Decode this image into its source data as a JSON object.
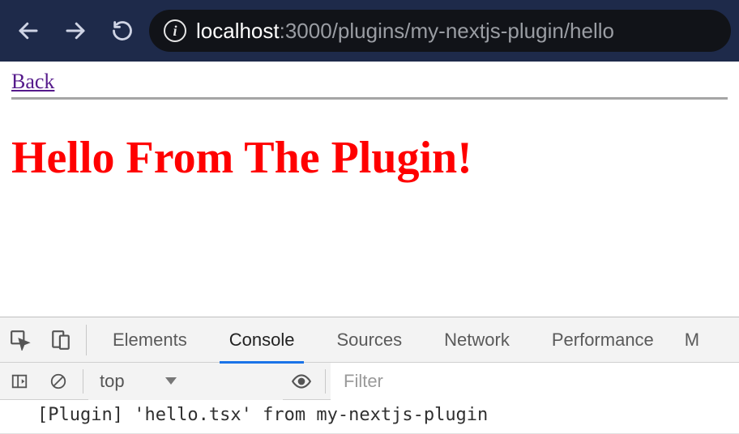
{
  "browser": {
    "url_host": "localhost",
    "url_path": ":3000/plugins/my-nextjs-plugin/hello"
  },
  "page": {
    "back_label": "Back",
    "heading": "Hello From The Plugin!"
  },
  "devtools": {
    "tabs": {
      "elements": "Elements",
      "console": "Console",
      "sources": "Sources",
      "network": "Network",
      "performance": "Performance",
      "more": "M"
    },
    "context_label": "top",
    "filter_placeholder": "Filter",
    "console_line": "[Plugin] 'hello.tsx' from my-nextjs-plugin"
  }
}
